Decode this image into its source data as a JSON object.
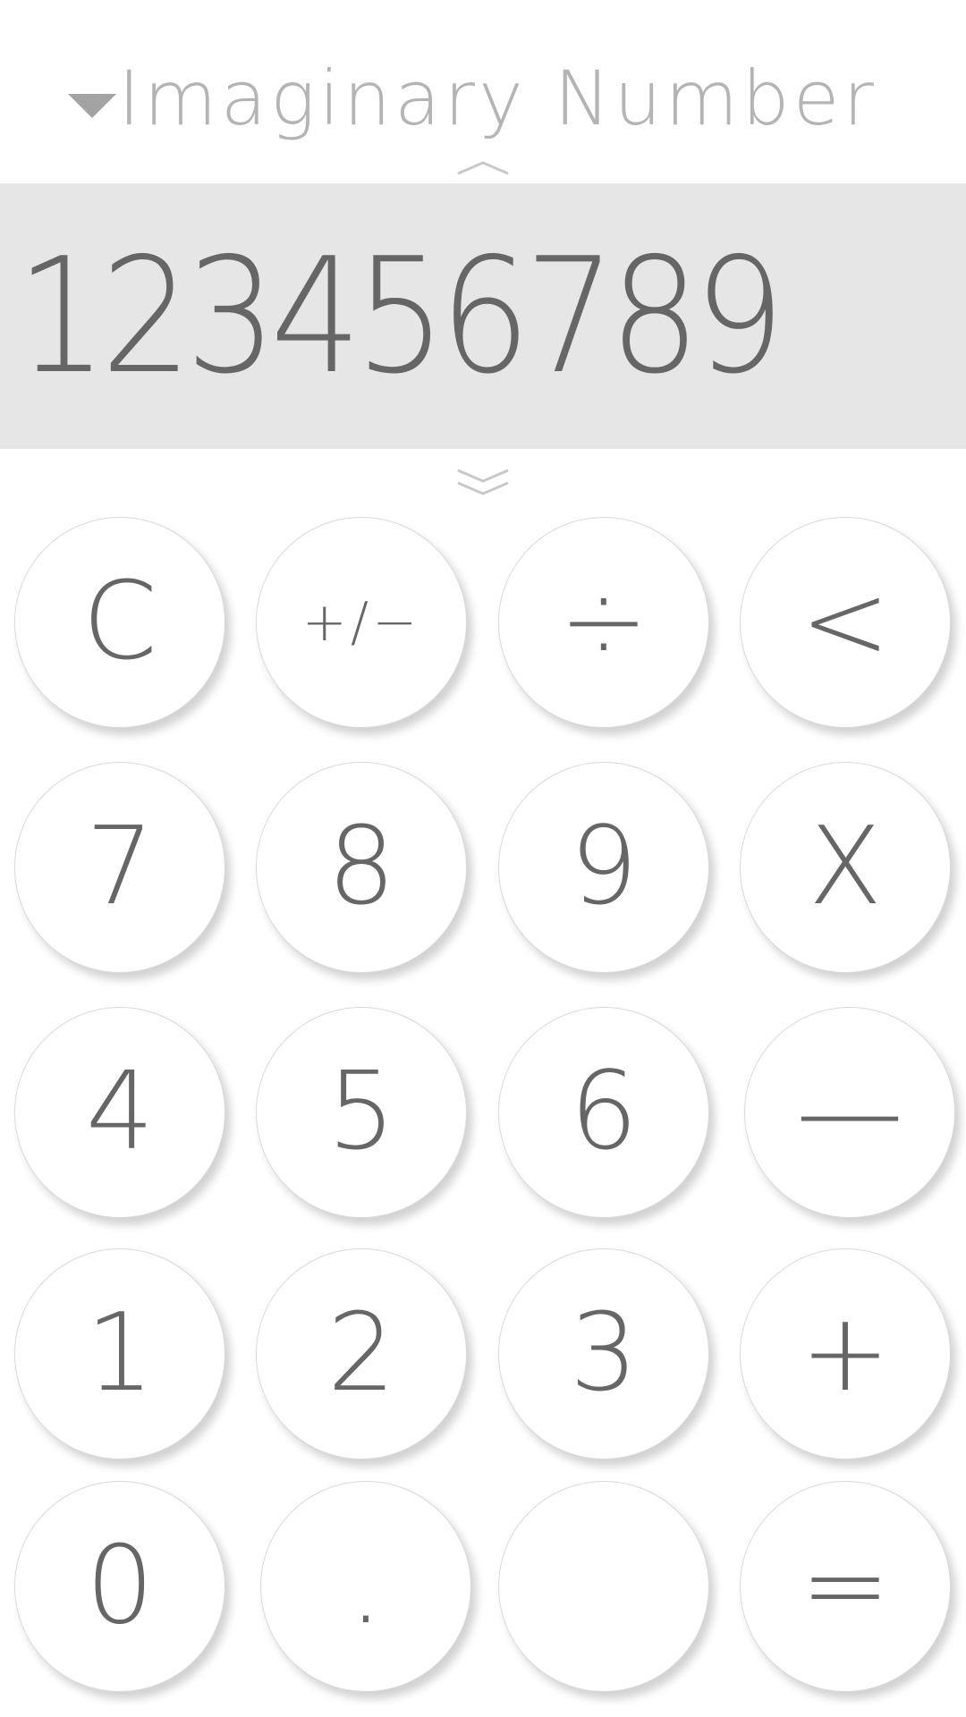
{
  "header": {
    "mode_title": "Imaginary Number",
    "dropdown_icon": "triangle-down-icon",
    "collapse_icon": "chevron-up-icon"
  },
  "display": {
    "value": "123456789",
    "expand_icon": "double-chevron-down-icon"
  },
  "keypad": {
    "row1": [
      "C",
      "+/−",
      "÷",
      "<"
    ],
    "row2": [
      "7",
      "8",
      "9",
      "X"
    ],
    "row3": [
      "4",
      "5",
      "6",
      "—"
    ],
    "row4": [
      "1",
      "2",
      "3",
      "+"
    ],
    "row5": [
      "0",
      ".",
      "",
      "="
    ]
  },
  "colors": {
    "display_background": "#e6e6e6",
    "text": "#666666",
    "title": "#b4b4b4",
    "key_background": "#ffffff"
  }
}
